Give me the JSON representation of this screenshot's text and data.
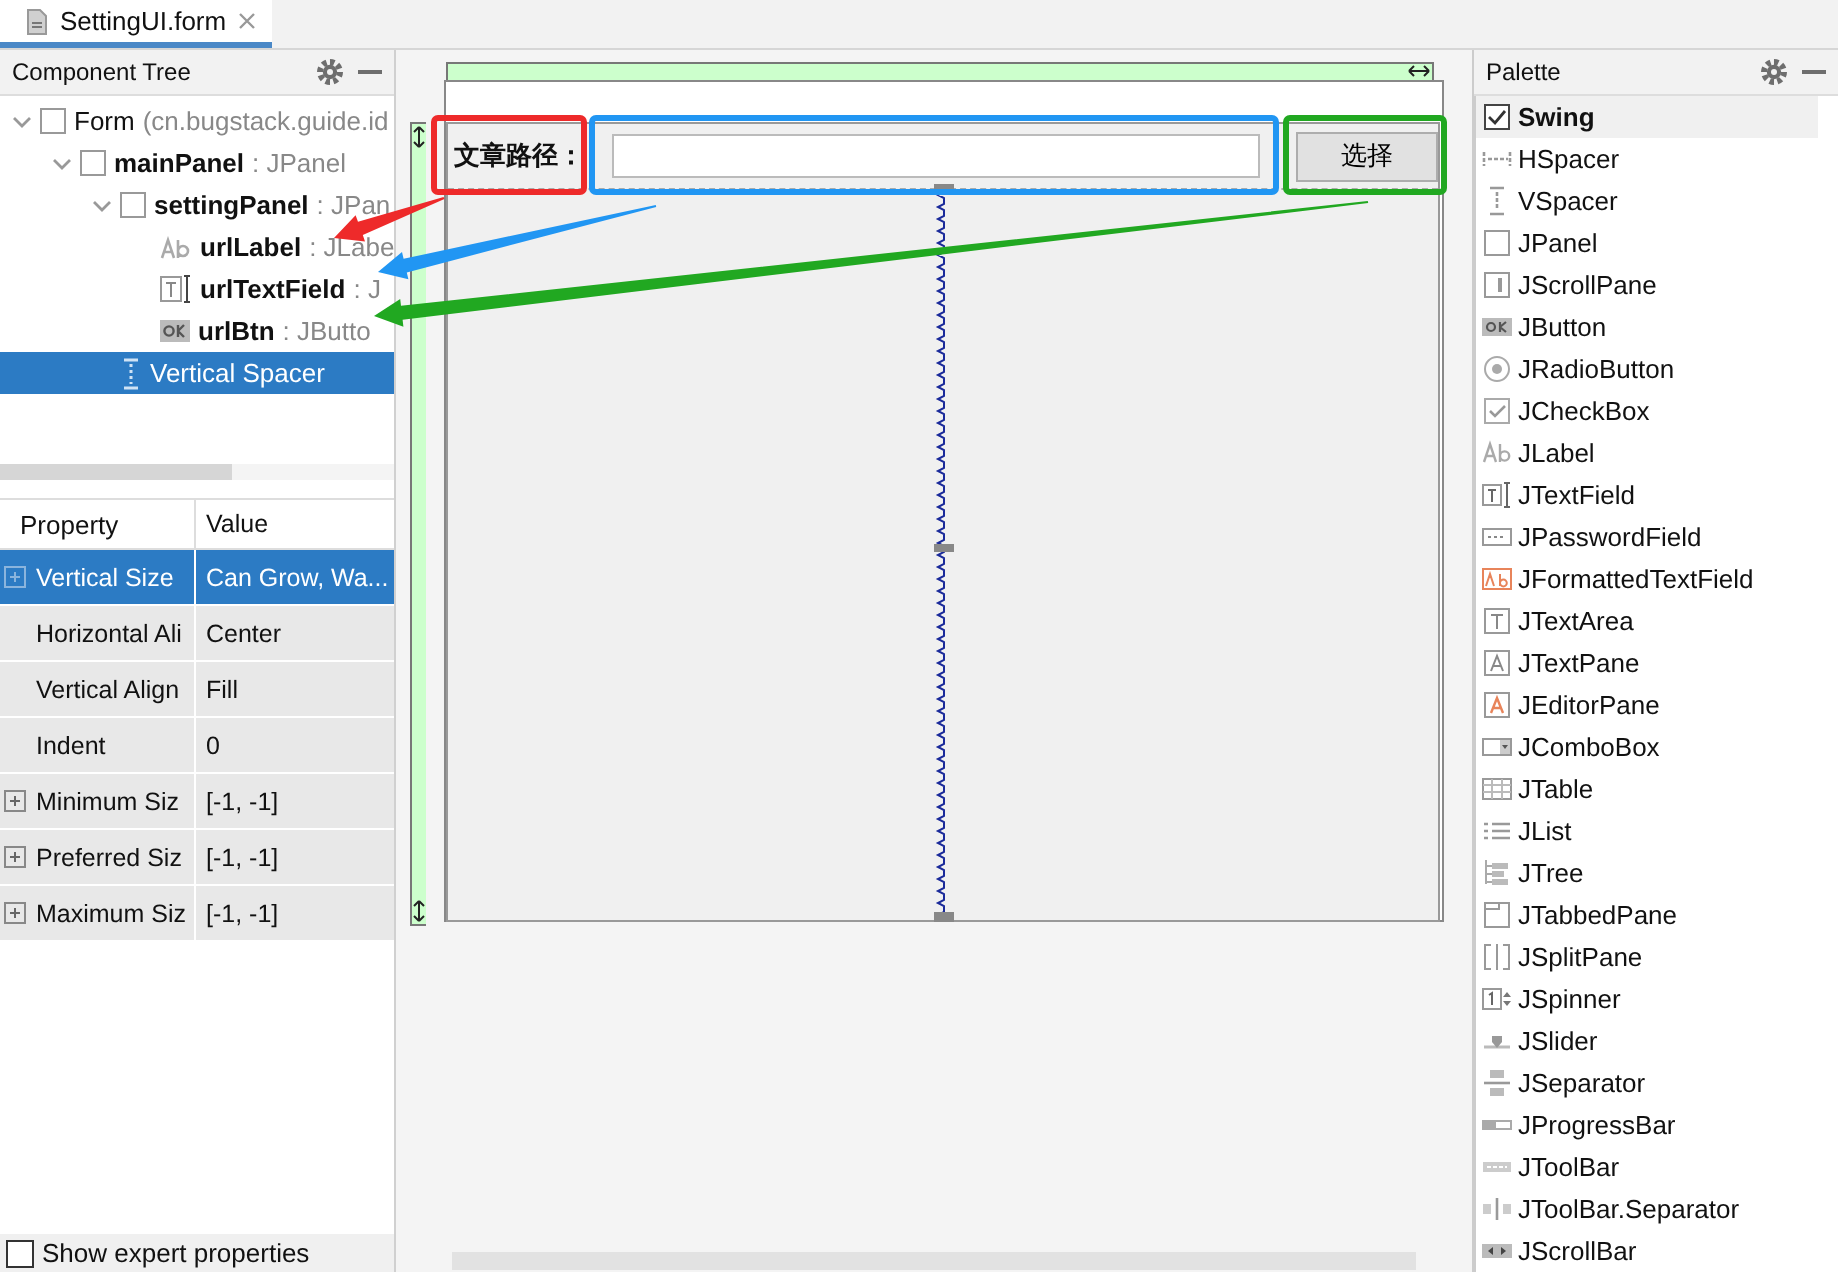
{
  "editor_tab": {
    "title": "SettingUI.form",
    "selected": true
  },
  "component_tree": {
    "title": "Component Tree",
    "items": [
      {
        "name": "Form",
        "type": "(cn.bugstack.guide.id",
        "kind": "form",
        "expanded": true,
        "selected": false,
        "children": [
          {
            "name": "mainPanel",
            "type": ": JPanel",
            "kind": "panel",
            "expanded": true,
            "selected": false,
            "children": [
              {
                "name": "settingPanel",
                "type": ": JPan",
                "kind": "panel",
                "expanded": true,
                "selected": false,
                "children": [
                  {
                    "name": "urlLabel",
                    "type": ": JLabe",
                    "kind": "label",
                    "selected": false
                  },
                  {
                    "name": "urlTextField",
                    "type": ": J",
                    "kind": "textfield",
                    "selected": false
                  },
                  {
                    "name": "urlBtn",
                    "type": ": JButto",
                    "kind": "button",
                    "selected": false
                  }
                ]
              },
              {
                "name": "Vertical Spacer",
                "kind": "spacer",
                "selected": true
              }
            ]
          }
        ]
      }
    ]
  },
  "properties": {
    "columns": [
      "Property",
      "Value"
    ],
    "rows": [
      {
        "name": "Vertical Size",
        "value": "Can Grow, Wa...",
        "expandable": true,
        "selected": true
      },
      {
        "name": "Horizontal Ali",
        "value": "Center",
        "expandable": false,
        "selected": false
      },
      {
        "name": "Vertical Align",
        "value": "Fill",
        "expandable": false,
        "selected": false
      },
      {
        "name": "Indent",
        "value": "0",
        "expandable": false,
        "selected": false
      },
      {
        "name": "Minimum Siz",
        "value": "[-1, -1]",
        "expandable": true,
        "selected": false
      },
      {
        "name": "Preferred Siz",
        "value": "[-1, -1]",
        "expandable": true,
        "selected": false
      },
      {
        "name": "Maximum Siz",
        "value": "[-1, -1]",
        "expandable": true,
        "selected": false
      }
    ],
    "expert": {
      "label": "Show expert properties",
      "checked": false
    }
  },
  "form": {
    "label": "文章路径：",
    "button": "选择"
  },
  "annotations": [
    {
      "color": "#ee2a2a"
    },
    {
      "color": "#2196f3"
    },
    {
      "color": "#21a821"
    }
  ],
  "palette": {
    "title": "Palette",
    "group": {
      "label": "Swing",
      "checked": true
    },
    "items": [
      {
        "label": "HSpacer",
        "kind": "hspacer"
      },
      {
        "label": "VSpacer",
        "kind": "vspacer"
      },
      {
        "label": "JPanel",
        "kind": "panel"
      },
      {
        "label": "JScrollPane",
        "kind": "scrollpane"
      },
      {
        "label": "JButton",
        "kind": "button"
      },
      {
        "label": "JRadioButton",
        "kind": "radio"
      },
      {
        "label": "JCheckBox",
        "kind": "checkbox"
      },
      {
        "label": "JLabel",
        "kind": "label"
      },
      {
        "label": "JTextField",
        "kind": "textfield"
      },
      {
        "label": "JPasswordField",
        "kind": "password"
      },
      {
        "label": "JFormattedTextField",
        "kind": "formatted"
      },
      {
        "label": "JTextArea",
        "kind": "textarea"
      },
      {
        "label": "JTextPane",
        "kind": "textpane"
      },
      {
        "label": "JEditorPane",
        "kind": "editorpane"
      },
      {
        "label": "JComboBox",
        "kind": "combobox"
      },
      {
        "label": "JTable",
        "kind": "table"
      },
      {
        "label": "JList",
        "kind": "list"
      },
      {
        "label": "JTree",
        "kind": "tree"
      },
      {
        "label": "JTabbedPane",
        "kind": "tabbed"
      },
      {
        "label": "JSplitPane",
        "kind": "split"
      },
      {
        "label": "JSpinner",
        "kind": "spinner"
      },
      {
        "label": "JSlider",
        "kind": "slider"
      },
      {
        "label": "JSeparator",
        "kind": "separator"
      },
      {
        "label": "JProgressBar",
        "kind": "progress"
      },
      {
        "label": "JToolBar",
        "kind": "toolbar"
      },
      {
        "label": "JToolBar.Separator",
        "kind": "toolbarsep"
      },
      {
        "label": "JScrollBar",
        "kind": "scrollbar"
      }
    ]
  }
}
